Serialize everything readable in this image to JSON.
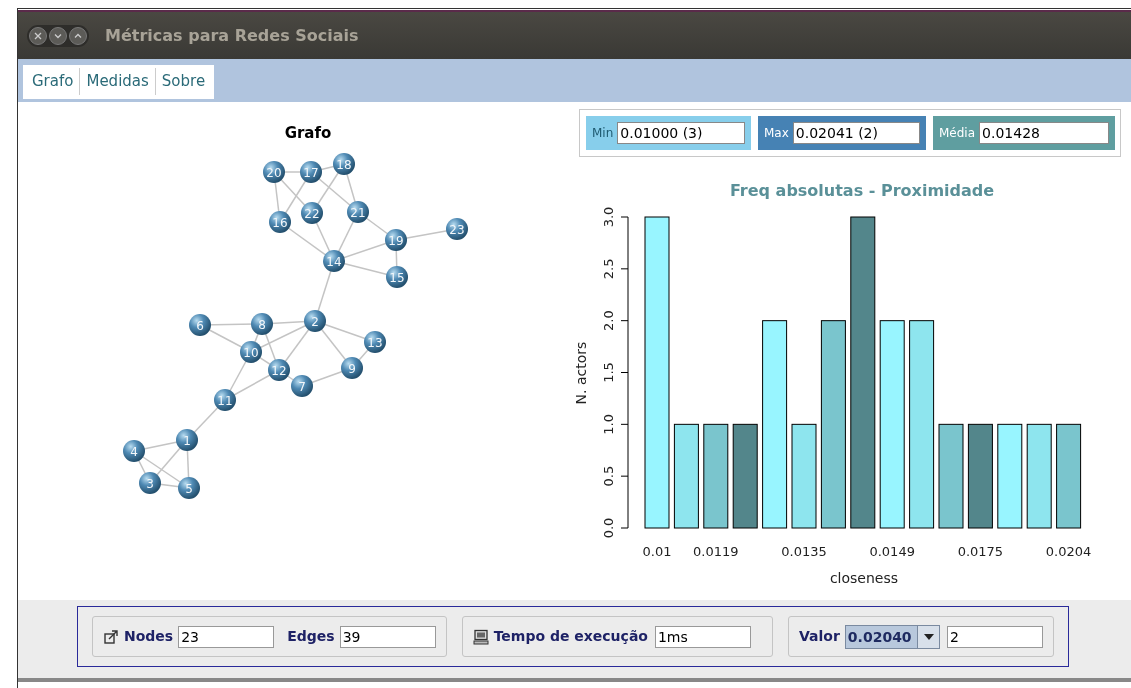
{
  "window": {
    "title": "Métricas para Redes Sociais"
  },
  "menu": [
    {
      "label": "Grafo"
    },
    {
      "label": "Medidas"
    },
    {
      "label": "Sobre"
    }
  ],
  "graph": {
    "title": "Grafo",
    "nodes": [
      "1",
      "2",
      "3",
      "4",
      "5",
      "6",
      "7",
      "8",
      "9",
      "10",
      "11",
      "12",
      "13",
      "14",
      "15",
      "16",
      "17",
      "18",
      "19",
      "20",
      "21",
      "22",
      "23"
    ]
  },
  "stats": [
    {
      "label": "Min",
      "value": "0.01000 (3)",
      "color": "#87ceeb"
    },
    {
      "label": "Max",
      "value": "0.02041 (2)",
      "color": "#4682b4"
    },
    {
      "label": "Média",
      "value": "0.01428",
      "color": "#5f9ea0"
    }
  ],
  "chart": {
    "chart_data": {
      "type": "bar",
      "title": "Freq absolutas - Proximidade",
      "xlabel": "closeness",
      "ylabel": "N. actors",
      "categories": [
        "0.01",
        null,
        "0.0119",
        null,
        null,
        "0.0135",
        null,
        null,
        "0.0149",
        null,
        null,
        "0.0175",
        null,
        null,
        "0.0204"
      ],
      "series": [
        {
          "color": "#98f5ff",
          "values": [
            3,
            null,
            null,
            null,
            2,
            null,
            null,
            null,
            2,
            null,
            null,
            null,
            1,
            null,
            null
          ]
        },
        {
          "color": "#8ee5ee",
          "values": [
            null,
            1,
            null,
            null,
            null,
            1,
            null,
            null,
            null,
            2,
            null,
            null,
            null,
            1,
            null
          ]
        },
        {
          "color": "#7ac5cd",
          "values": [
            null,
            null,
            1,
            null,
            null,
            null,
            2,
            null,
            null,
            null,
            1,
            null,
            null,
            null,
            1
          ]
        },
        {
          "color": "#53868b",
          "values": [
            null,
            null,
            null,
            1,
            null,
            null,
            null,
            3,
            null,
            null,
            null,
            1,
            null,
            null,
            null
          ]
        }
      ],
      "ylim": [
        0,
        3
      ],
      "yticks": [
        {
          "value": 0,
          "label": "0.0"
        },
        {
          "value": 0.5,
          "label": "0.5"
        },
        {
          "value": 1,
          "label": "1.0"
        },
        {
          "value": 1.5,
          "label": "1.5"
        },
        {
          "value": 2,
          "label": "2.0"
        },
        {
          "value": 2.5,
          "label": "2.5"
        },
        {
          "value": 3,
          "label": "3.0"
        }
      ]
    }
  },
  "footer": {
    "nodes": {
      "label": "Nodes",
      "value": "23"
    },
    "edges": {
      "label": "Edges",
      "value": "39"
    },
    "time": {
      "label": "Tempo de execução",
      "value": "1ms"
    },
    "valor": {
      "label": "Valor",
      "selected": "0.02040",
      "value": "2"
    }
  }
}
